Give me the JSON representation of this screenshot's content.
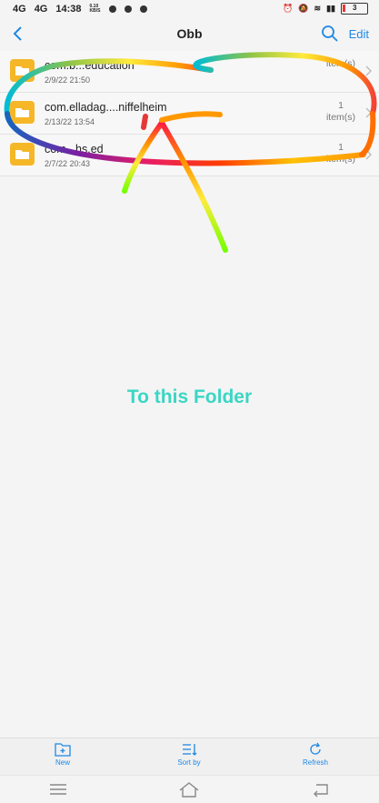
{
  "status": {
    "net1": "4G",
    "net2": "4G",
    "time": "14:38",
    "speed": "0.10 KB/S",
    "battery_level": "3",
    "battery_color": "#e53935"
  },
  "header": {
    "title": "Obb",
    "edit_label": "Edit",
    "back_icon": "chevron-left-icon",
    "search_icon": "search-icon",
    "accent": "#1e88e5"
  },
  "files": [
    {
      "name": "com.b...education",
      "date": "2/9/22 21:50",
      "count": "",
      "unit": "item(s)"
    },
    {
      "name": "com.elladag....niffelheim",
      "date": "2/13/22 13:54",
      "count": "1",
      "unit": "item(s)"
    },
    {
      "name": "com...hs.ed",
      "date": "2/7/22 20:43",
      "count": "1",
      "unit": "item(s)"
    }
  ],
  "annotation": {
    "caption": "To this Folder",
    "caption_color": "#3ad6c4"
  },
  "toolbar": {
    "new_label": "New",
    "sort_label": "Sort by",
    "refresh_label": "Refresh"
  },
  "nav": {
    "menu_icon": "menu-icon",
    "home_icon": "home-icon",
    "back_icon": "back-icon"
  }
}
